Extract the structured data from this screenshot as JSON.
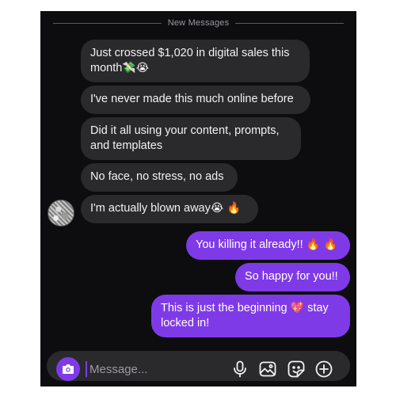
{
  "divider": {
    "label": "New Messages"
  },
  "incoming": [
    {
      "text": "Just crossed $1,020 in digital sales this month",
      "emoji": "💸😭"
    },
    {
      "text": "I've never made this much online before",
      "emoji": ""
    },
    {
      "text": "Did it all using your content, prompts, and templates",
      "emoji": ""
    },
    {
      "text": "No face, no stress, no ads",
      "emoji": ""
    },
    {
      "text": "I'm actually blown away",
      "emoji": "😭 🔥"
    }
  ],
  "outgoing": [
    {
      "text": "You killing it already!!",
      "emoji": "🔥 🔥"
    },
    {
      "text": "So happy for you!!",
      "emoji": ""
    },
    {
      "text": "This is just the beginning",
      "emoji": "💖",
      "text_after": "stay locked in!"
    }
  ],
  "composer": {
    "placeholder": "Message..."
  },
  "icons": [
    "camera-icon",
    "microphone-icon",
    "gallery-icon",
    "sticker-icon",
    "add-icon"
  ],
  "colors": {
    "accent": "#7f3ae8",
    "incoming_bubble": "#2a2a2d",
    "background": "#0d0d0f"
  }
}
